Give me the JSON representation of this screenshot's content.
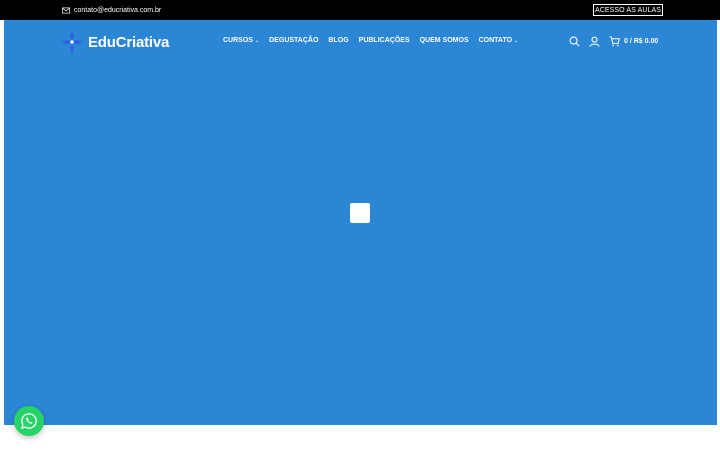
{
  "topbar": {
    "email": "contato@educriativa.com.br",
    "email_icon": "envelope-icon",
    "access_button": "ACESSO AS AULAS",
    "background": "#000000"
  },
  "header": {
    "logo_text": "EduCriativa",
    "logo_icon": "sparkle-cross-icon",
    "nav": [
      {
        "label": "CURSOS",
        "has_dropdown": true
      },
      {
        "label": "DEGUSTAÇÃO",
        "has_dropdown": false
      },
      {
        "label": "BLOG",
        "has_dropdown": false
      },
      {
        "label": "PUBLICAÇÕES",
        "has_dropdown": false
      },
      {
        "label": "QUEM SOMOS",
        "has_dropdown": false
      },
      {
        "label": "CONTATO",
        "has_dropdown": true
      }
    ],
    "cart_text": "0 / R$ 0.00",
    "icons": [
      "search-icon",
      "user-icon",
      "cart-icon"
    ]
  },
  "hero": {
    "background": "#2c86d6",
    "loader": "loading-indicator"
  },
  "whatsapp": {
    "icon": "whatsapp-icon",
    "color": "#25d366"
  }
}
